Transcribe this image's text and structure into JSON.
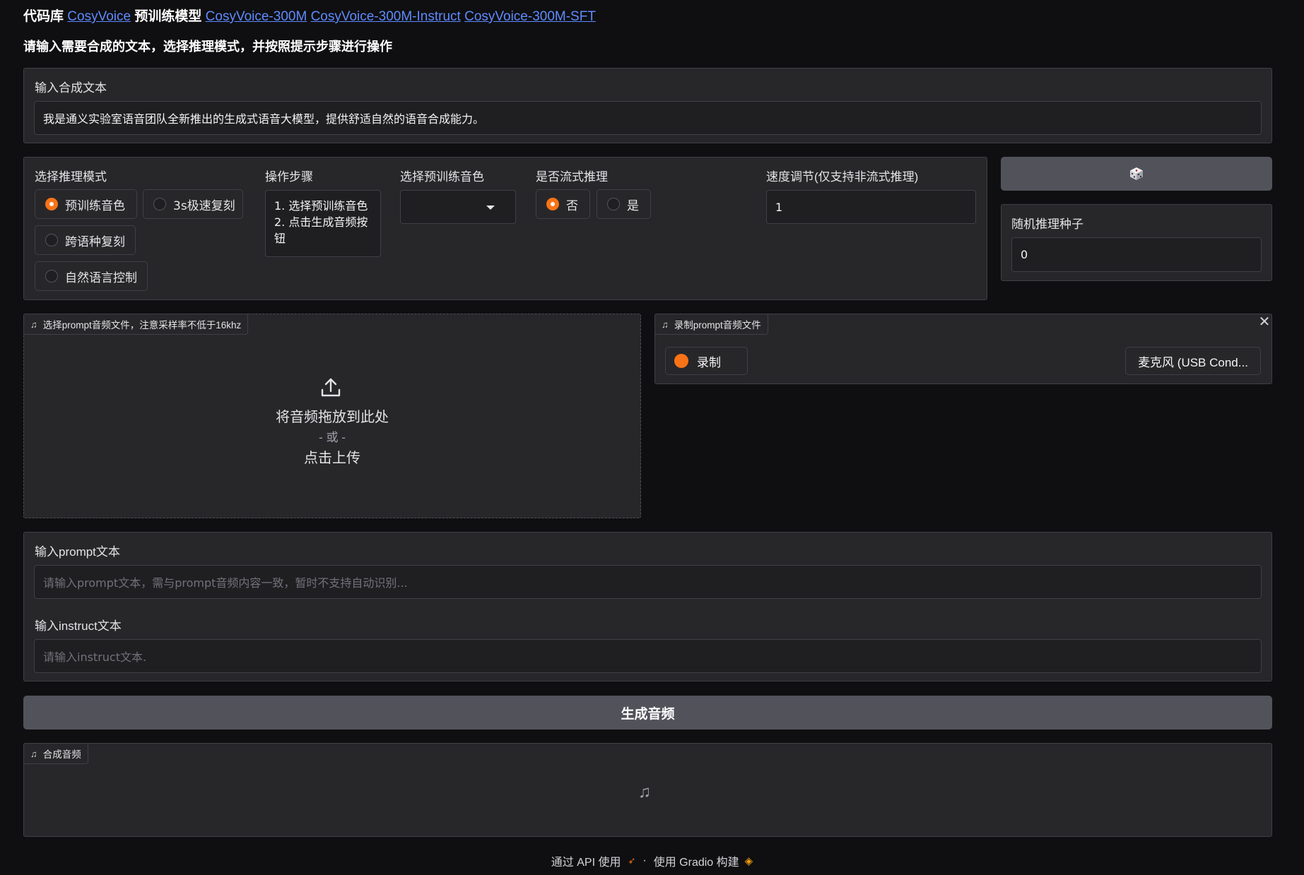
{
  "header": {
    "repo_label": "代码库",
    "repo_link": "CosyVoice",
    "models_label": "预训练模型",
    "model_links": [
      "CosyVoice-300M",
      "CosyVoice-300M-Instruct",
      "CosyVoice-300M-SFT"
    ]
  },
  "subtitle": "请输入需要合成的文本，选择推理模式，并按照提示步骤进行操作",
  "tts_text": {
    "label": "输入合成文本",
    "value": "我是通义实验室语音团队全新推出的生成式语音大模型，提供舒适自然的语音合成能力。"
  },
  "mode": {
    "label": "选择推理模式",
    "options": [
      "预训练音色",
      "3s极速复刻",
      "跨语种复刻",
      "自然语言控制"
    ],
    "selected": "预训练音色"
  },
  "steps": {
    "label": "操作步骤",
    "lines": [
      "1. 选择预训练音色",
      "2. 点击生成音频按",
      "钮"
    ]
  },
  "voice": {
    "label": "选择预训练音色",
    "value": ""
  },
  "stream": {
    "label": "是否流式推理",
    "options": [
      "否",
      "是"
    ],
    "selected": "否"
  },
  "speed": {
    "label": "速度调节(仅支持非流式推理)",
    "value": "1"
  },
  "dice_button": {
    "icon": "dice-icon"
  },
  "seed": {
    "label": "随机推理种子",
    "value": "0"
  },
  "upload": {
    "badge": "选择prompt音频文件，注意采样率不低于16khz",
    "line1": "将音频拖放到此处",
    "line2": "- 或 -",
    "line3": "点击上传"
  },
  "record": {
    "badge": "录制prompt音频文件",
    "record_label": "录制",
    "mic_label": "麦克风 (USB Cond..."
  },
  "prompt_text": {
    "label": "输入prompt文本",
    "placeholder": "请输入prompt文本，需与prompt音频内容一致，暂时不支持自动识别..."
  },
  "instruct_text": {
    "label": "输入instruct文本",
    "placeholder": "请输入instruct文本."
  },
  "generate": {
    "label": "生成音频"
  },
  "output_audio": {
    "badge": "合成音频"
  },
  "footer": {
    "api": "通过 API 使用",
    "separator": "·",
    "built": "使用 Gradio 构建"
  },
  "colors": {
    "accent": "#f97316",
    "link": "#5e8bff",
    "panel": "#27272a",
    "button": "#52525b"
  }
}
